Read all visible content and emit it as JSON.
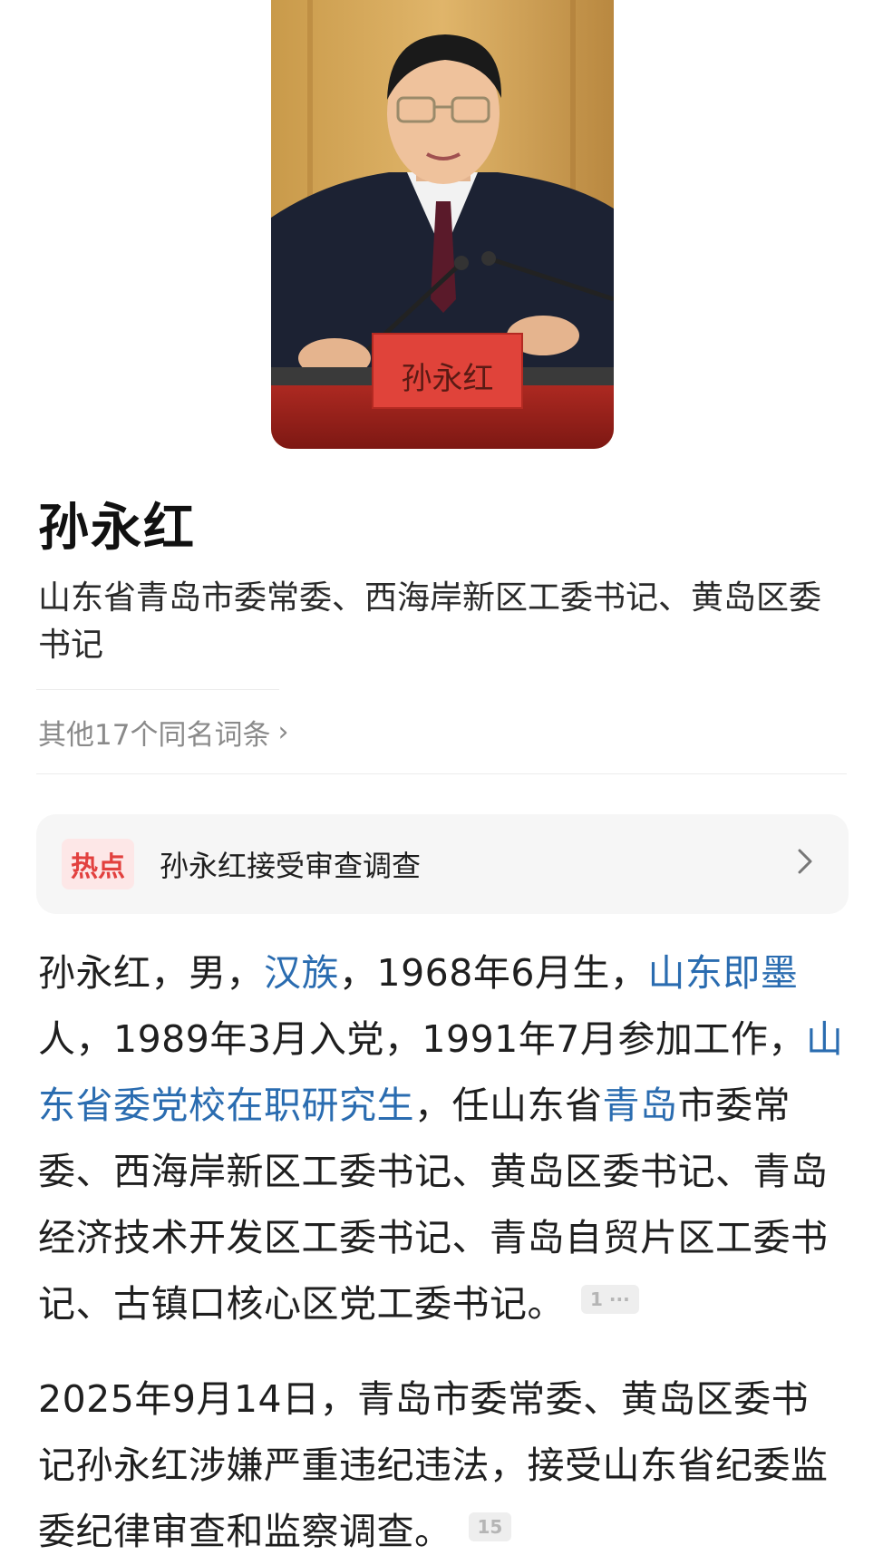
{
  "header": {
    "nameplate_text": "孙永红"
  },
  "entry": {
    "title": "孙永红",
    "subtitle": "山东省青岛市委常委、西海岸新区工委书记、黄岛区委书记",
    "other_entries": "其他17个同名词条"
  },
  "hot": {
    "badge": "热点",
    "text": "孙永红接受审查调查"
  },
  "para1": {
    "t1": "孙永红，男，",
    "link1": "汉族",
    "t2": "，1968年6月生，",
    "link2": "山东即墨",
    "t3": "人，1989年3月入党，1991年7月参加工作，",
    "link3": "山东省委党校在职研究生",
    "t4": "，任山东省",
    "link4": "青岛",
    "t5": "市委常委、西海岸新区工委书记、黄岛区委书记、青岛经济技术开发区工委书记、青岛自贸片区工委书记、古镇口核心区党工委书记。",
    "ref": "1 ···"
  },
  "para2": {
    "text": "2025年9月14日，青岛市委常委、黄岛区委书记孙永红涉嫌严重违纪违法，接受山东省纪委监委纪律审查和监察调查。",
    "ref": "15"
  },
  "colors": {
    "link": "#2a6cb0",
    "hot_badge_text": "#e2403e",
    "hot_badge_bg": "#fde7e7"
  }
}
